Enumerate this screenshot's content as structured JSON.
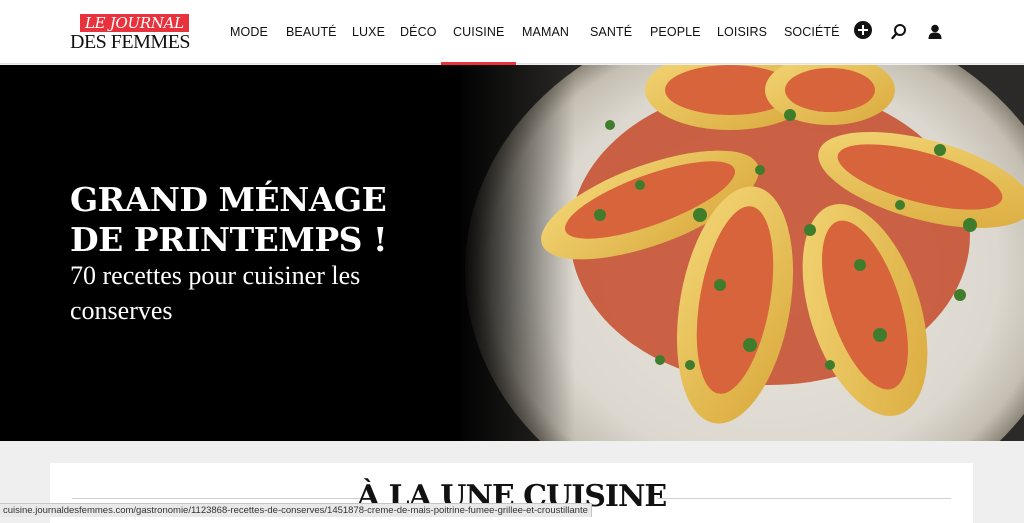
{
  "header": {
    "logo": {
      "line1": "LE JOURNAL",
      "line2": "DES FEMMES"
    },
    "nav": [
      {
        "label": "MODE"
      },
      {
        "label": "BEAUTÉ"
      },
      {
        "label": "LUXE"
      },
      {
        "label": "DÉCO"
      },
      {
        "label": "CUISINE",
        "active": true
      },
      {
        "label": "MAMAN"
      },
      {
        "label": "SANTÉ"
      },
      {
        "label": "PEOPLE"
      },
      {
        "label": "LOISIRS"
      },
      {
        "label": "SOCIÉTÉ"
      }
    ],
    "icons": [
      "plus-icon",
      "search-icon",
      "user-icon"
    ],
    "accent_color": "#e8333d"
  },
  "hero": {
    "title": "GRAND MÉNAGE DE PRINTEMPS !",
    "subtitle": "70 recettes pour cuisiner les conserves"
  },
  "section": {
    "title": "À LA UNE CUISINE"
  },
  "statusbar": {
    "url": "cuisine.journaldesfemmes.com/gastronomie/1123868-recettes-de-conserves/1451878-creme-de-mais-poitrine-fumee-grillee-et-croustillante"
  }
}
